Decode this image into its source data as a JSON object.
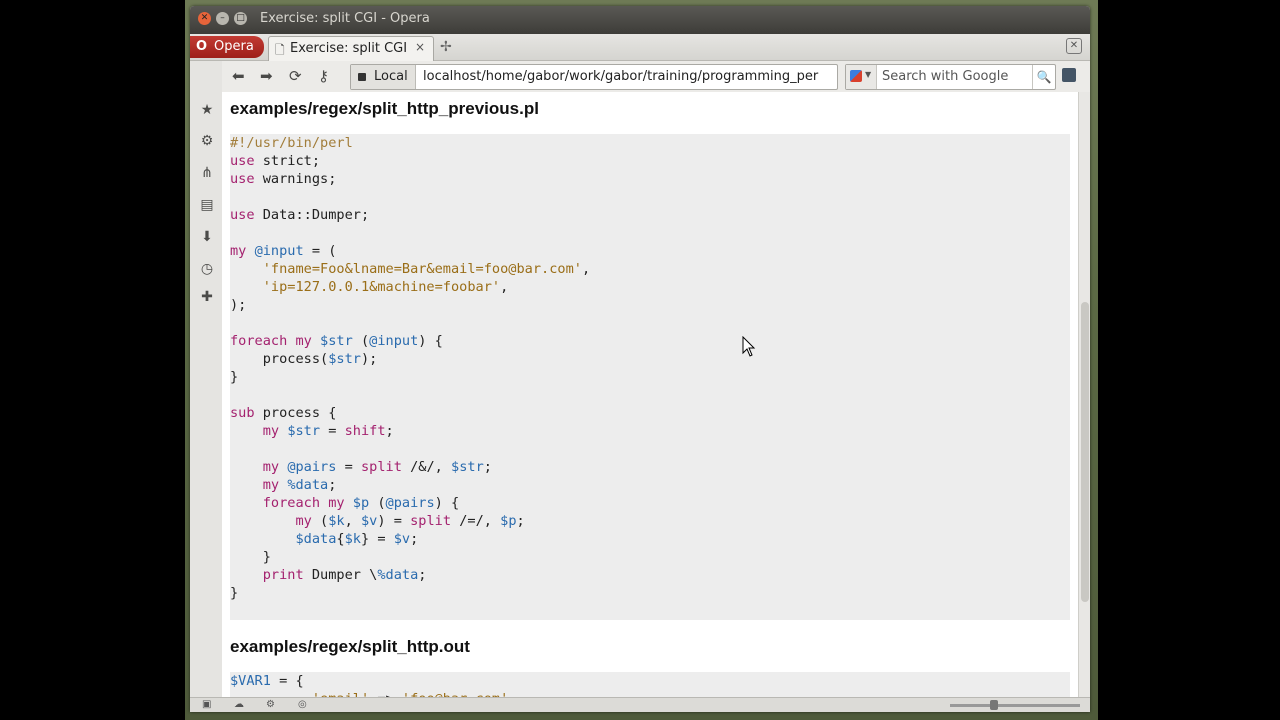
{
  "window": {
    "title": "Exercise: split CGI - Opera"
  },
  "tabbar": {
    "menu_label": "Opera",
    "active_tab": "Exercise: split CGI",
    "close_glyph": "×",
    "new_tab_glyph": "✢"
  },
  "toolbar": {
    "back_icon": "arrow-left-icon",
    "forward_icon": "arrow-right-icon",
    "reload_icon": "reload-icon",
    "badge_label": "Local",
    "url": "localhost/home/gabor/work/gabor/training/programming_per",
    "search_placeholder": "Search with Google"
  },
  "content": {
    "file1_title": "examples/regex/split_http_previous.pl",
    "file2_title": "examples/regex/split_http.out"
  },
  "colors": {
    "keyword": "#a4226f",
    "variable": "#2a6bae",
    "string": "#9a6e18",
    "code_bg": "#ededed"
  }
}
